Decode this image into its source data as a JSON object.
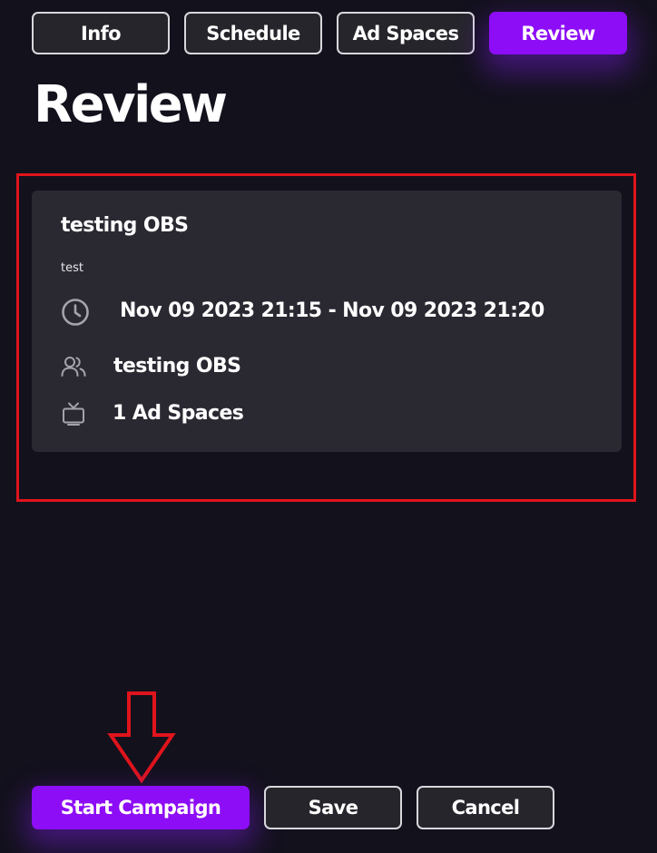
{
  "tabs": [
    {
      "label": "Info",
      "active": false
    },
    {
      "label": "Schedule",
      "active": false
    },
    {
      "label": "Ad Spaces",
      "active": false
    },
    {
      "label": "Review",
      "active": true
    }
  ],
  "page_title": "Review",
  "review_card": {
    "campaign_name": "testing OBS",
    "description": "test",
    "schedule": "Nov 09 2023 21:15 - Nov 09 2023 21:20",
    "audience": "testing OBS",
    "ad_spaces": "1 Ad Spaces",
    "icons": [
      "clock-icon",
      "users-icon",
      "tv-icon"
    ]
  },
  "actions": {
    "start_label": "Start Campaign",
    "save_label": "Save",
    "cancel_label": "Cancel"
  },
  "colors": {
    "background": "#13111c",
    "card": "#2a2932",
    "accent": "#8d0df7",
    "annotation": "#e0141c",
    "icon": "#a3a3ab"
  }
}
